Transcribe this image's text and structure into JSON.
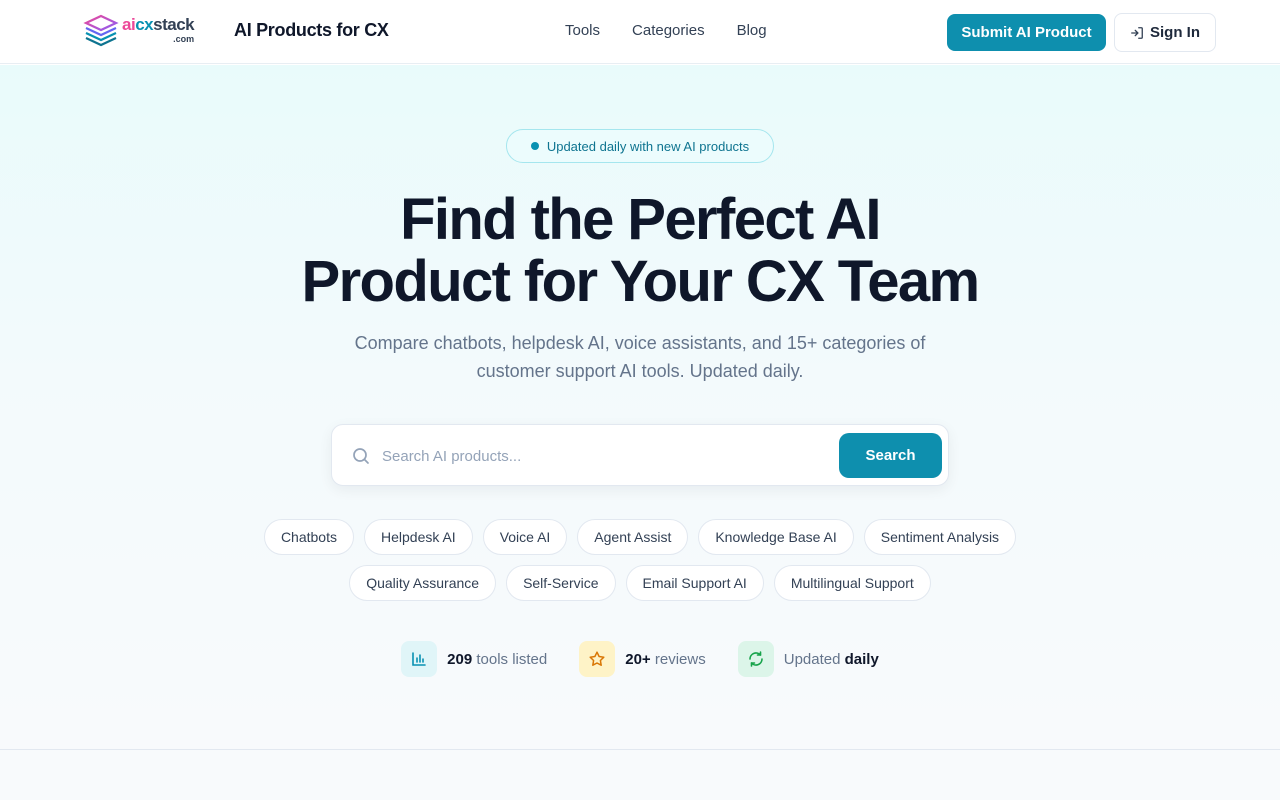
{
  "header": {
    "logo": {
      "word_a": "a",
      "word_i": "i",
      "word_cx": "cx",
      "word_stack": "stack",
      "dotcom": ".com"
    },
    "site_title": "AI Products for CX",
    "nav": [
      {
        "label": "Tools"
      },
      {
        "label": "Categories"
      },
      {
        "label": "Blog"
      }
    ],
    "submit_label": "Submit AI Product",
    "signin_label": "Sign In"
  },
  "hero": {
    "badge": "Updated daily with new AI products",
    "title_line1": "Find the Perfect AI",
    "title_line2": "Product for Your CX Team",
    "subtitle_line1": "Compare chatbots, helpdesk AI, voice assistants, and 15+ categories of",
    "subtitle_line2": "customer support AI tools. Updated daily.",
    "search": {
      "placeholder": "Search AI products...",
      "value": "",
      "button_label": "Search"
    },
    "categories_row1": [
      "Chatbots",
      "Helpdesk AI",
      "Voice AI",
      "Agent Assist",
      "Knowledge Base AI",
      "Sentiment Analysis"
    ],
    "categories_row2": [
      "Quality Assurance",
      "Self-Service",
      "Email Support AI",
      "Multilingual Support"
    ],
    "stats": {
      "tools_count": "209",
      "tools_label": "tools listed",
      "reviews_count": "20+",
      "reviews_label": "reviews",
      "updated_label": "Updated",
      "updated_value": "daily"
    }
  },
  "colors": {
    "brand": "#0e8fae",
    "title": "#0f172a",
    "muted": "#64748b",
    "hero_top": "#e9fbfb"
  },
  "icons": [
    "logo-mark-icon",
    "sign-in-icon",
    "search-icon",
    "bar-chart-icon",
    "star-icon",
    "refresh-icon"
  ]
}
